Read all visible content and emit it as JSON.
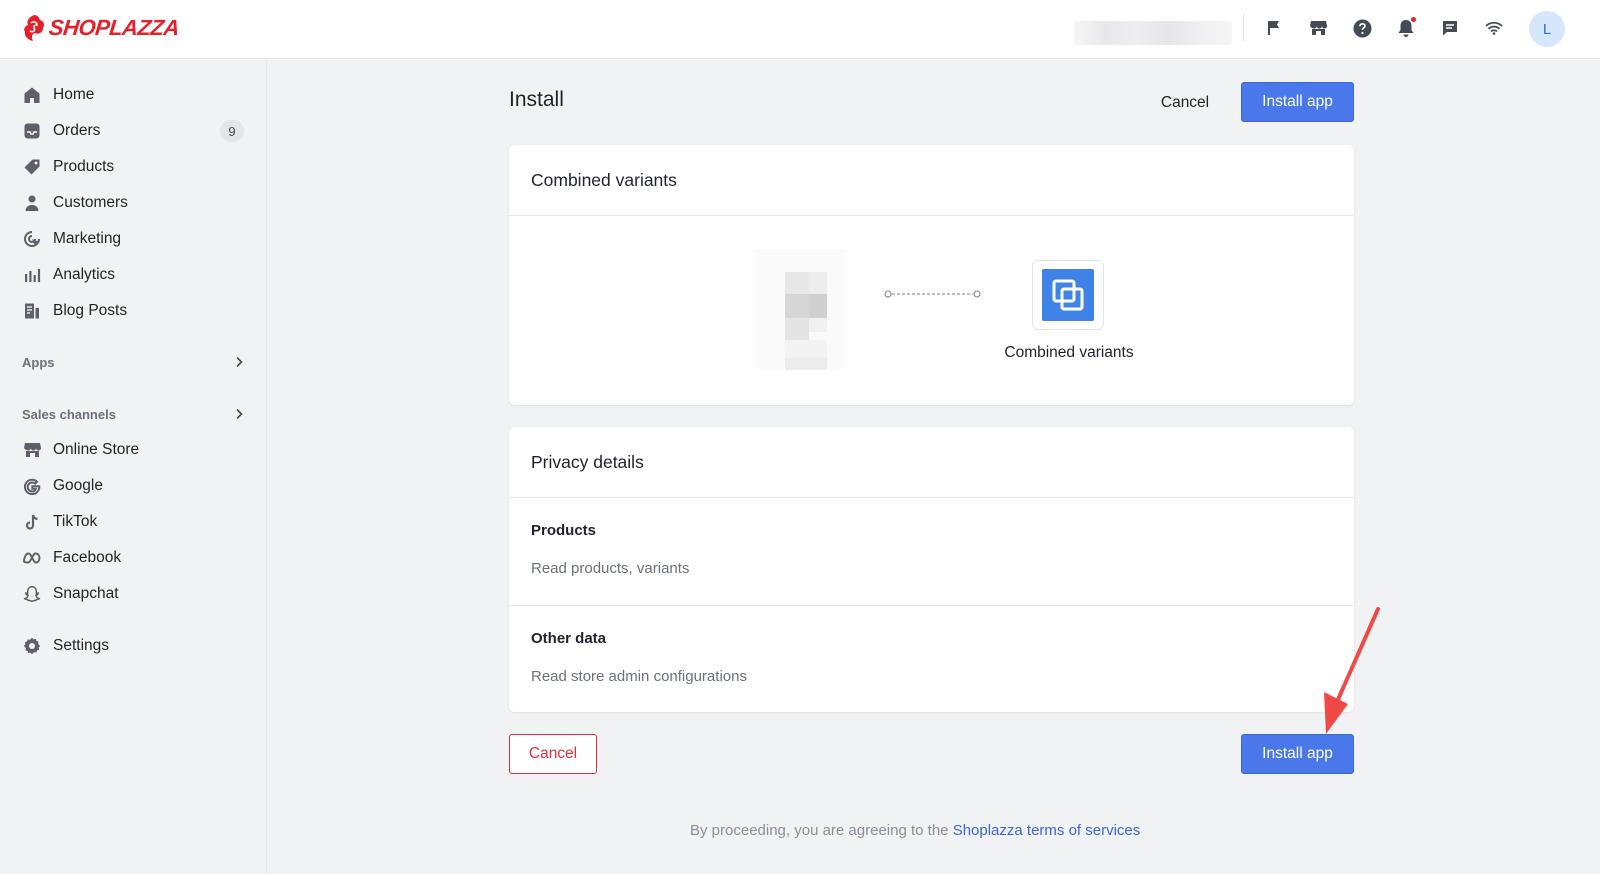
{
  "brand": {
    "name": "SHOPLAZZA",
    "color": "#e5202a",
    "accent": "#4a78ea"
  },
  "header": {
    "icons": [
      "flag-icon",
      "store-icon",
      "help-icon",
      "bell-icon",
      "chat-icon",
      "wifi-icon"
    ],
    "avatar_initial": "L"
  },
  "sidebar": {
    "items": [
      {
        "label": "Home",
        "icon": "home-icon"
      },
      {
        "label": "Orders",
        "icon": "inbox-icon",
        "badge": "9"
      },
      {
        "label": "Products",
        "icon": "tag-icon"
      },
      {
        "label": "Customers",
        "icon": "person-icon"
      },
      {
        "label": "Marketing",
        "icon": "marketing-icon"
      },
      {
        "label": "Analytics",
        "icon": "bar-chart-icon"
      },
      {
        "label": "Blog Posts",
        "icon": "blog-icon"
      }
    ],
    "apps_label": "Apps",
    "sales_channels_label": "Sales channels",
    "channels": [
      {
        "label": "Online Store",
        "icon": "store-icon"
      },
      {
        "label": "Google",
        "icon": "google-icon"
      },
      {
        "label": "TikTok",
        "icon": "tiktok-icon"
      },
      {
        "label": "Facebook",
        "icon": "meta-icon"
      },
      {
        "label": "Snapchat",
        "icon": "snapchat-icon"
      }
    ],
    "settings_label": "Settings"
  },
  "main": {
    "title": "Install",
    "cancel_label": "Cancel",
    "install_label": "Install app",
    "app_card": {
      "title": "Combined variants",
      "app_name": "Combined variants"
    },
    "privacy_card": {
      "title": "Privacy details",
      "sections": [
        {
          "title": "Products",
          "description": "Read products, variants"
        },
        {
          "title": "Other data",
          "description": "Read store admin configurations"
        }
      ]
    },
    "footer": {
      "cancel_label": "Cancel",
      "install_label": "Install app",
      "terms_prefix": "By proceeding, you are agreeing to the",
      "terms_link": "Shoplazza terms of services"
    }
  }
}
